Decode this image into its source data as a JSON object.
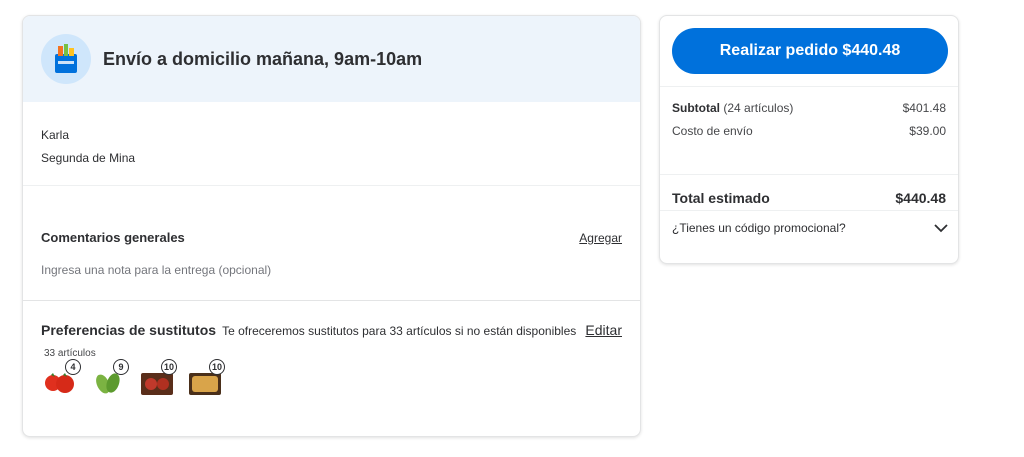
{
  "shipping": {
    "title": "Envío a domicilio mañana, 9am-10am",
    "icon": "walmart-bag-icon"
  },
  "address": {
    "name": "Karla",
    "line": "Segunda de Mina"
  },
  "comments": {
    "title": "Comentarios generales",
    "add_label": "Agregar",
    "placeholder": "Ingresa una nota para la entrega (opcional)"
  },
  "substitutes": {
    "title": "Preferencias de sustitutos",
    "description": "Te ofreceremos sustitutos para 33 artículos si no están disponibles",
    "edit_label": "Editar",
    "count_label": "33 artículos",
    "items": [
      {
        "icon": "tomato-icon",
        "qty": "4"
      },
      {
        "icon": "green-pepper-icon",
        "qty": "9"
      },
      {
        "icon": "meat-package-icon",
        "qty": "10"
      },
      {
        "icon": "bread-package-icon",
        "qty": "10"
      }
    ]
  },
  "summary": {
    "order_button": "Realizar pedido $440.48",
    "subtotal_label": "Subtotal",
    "subtotal_count": "(24 artículos)",
    "subtotal_value": "$401.48",
    "shipping_label": "Costo de envío",
    "shipping_value": "$39.00",
    "total_label": "Total estimado",
    "total_value": "$440.48",
    "promo_label": "¿Tienes un código promocional?"
  },
  "colors": {
    "accent": "#0071dc",
    "header_bg": "#edf4fb"
  }
}
